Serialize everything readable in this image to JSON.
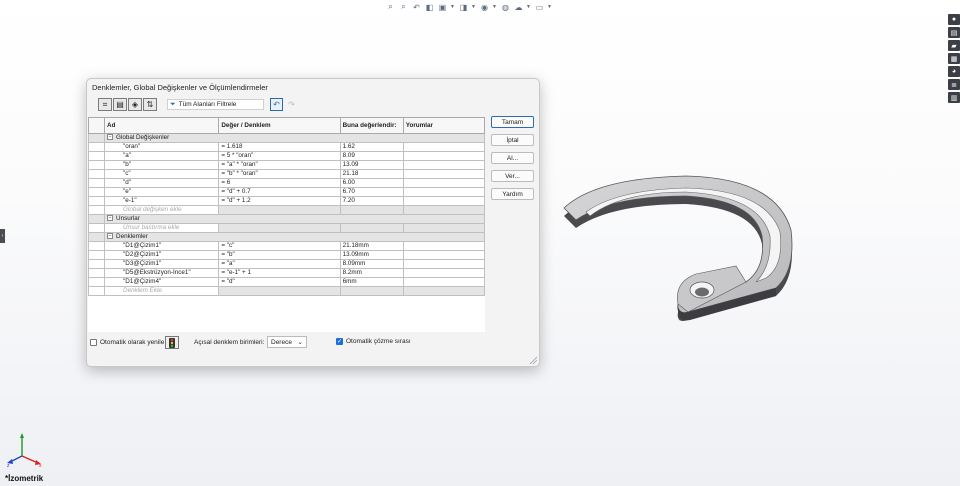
{
  "toolbar_icons": [
    "zoom-to-fit-icon",
    "zoom-area-icon",
    "previous-view-icon",
    "section-view-icon",
    "view-orientation-icon",
    "display-style-icon",
    "hide-show-icon",
    "edit-appearance-icon",
    "scene-icon",
    "view-settings-icon"
  ],
  "task_pane_icons": [
    "resources-icon",
    "design-library-icon",
    "file-explorer-icon",
    "view-palette-icon",
    "appearances-icon",
    "custom-properties-icon",
    "forum-icon"
  ],
  "dialog": {
    "title": "Denklemler, Global Değişkenler ve Ölçümlendirmeler",
    "filter_label": "Tüm Alanları Filtrele",
    "columns": [
      "Ad",
      "Değer / Denklem",
      "Buna değerlendir:",
      "Yorumlar"
    ],
    "sections": {
      "globals": {
        "header": "Global Değişkenler",
        "rows": [
          {
            "name": "\"oran\"",
            "eq": "= 1.618",
            "val": "1.62",
            "comment": ""
          },
          {
            "name": "\"a\"",
            "eq": "= 5 * \"oran\"",
            "val": "8.09",
            "comment": ""
          },
          {
            "name": "\"b\"",
            "eq": "= \"a\" * \"oran\"",
            "val": "13.09",
            "comment": ""
          },
          {
            "name": "\"c\"",
            "eq": "= \"b\" * \"oran\"",
            "val": "21.18",
            "comment": ""
          },
          {
            "name": "\"d\"",
            "eq": "= 6",
            "val": "6.00",
            "comment": ""
          },
          {
            "name": "\"e\"",
            "eq": "= \"d\" + 0.7",
            "val": "6.70",
            "comment": ""
          },
          {
            "name": "\"e-1\"",
            "eq": "= \"d\" + 1.2",
            "val": "7.20",
            "comment": ""
          }
        ],
        "placeholder": "Global değişken ekle"
      },
      "features": {
        "header": "Unsurlar",
        "placeholder": "Unsur bastırma ekle"
      },
      "equations": {
        "header": "Denklemler",
        "rows": [
          {
            "name": "\"D1@Çizim1\"",
            "eq": "= \"c\"",
            "val": "21.18mm",
            "comment": ""
          },
          {
            "name": "\"D2@Çizim1\"",
            "eq": "= \"b\"",
            "val": "13.09mm",
            "comment": ""
          },
          {
            "name": "\"D3@Çizim1\"",
            "eq": "= \"a\"",
            "val": "8.09mm",
            "comment": ""
          },
          {
            "name": "\"D5@Ekstrüzyon-İnce1\"",
            "eq": "= \"e-1\" + 1",
            "val": "8.2mm",
            "comment": ""
          },
          {
            "name": "\"D1@Çizim4\"",
            "eq": "= \"d\"",
            "val": "6mm",
            "comment": ""
          }
        ],
        "placeholder": "Denklem Ekle"
      }
    },
    "buttons": {
      "ok": "Tamam",
      "cancel": "İptal",
      "import": "Al...",
      "export": "Ver...",
      "help": "Yardım"
    },
    "auto_rebuild_label": "Otomatik olarak yenile",
    "angle_units_label": "Açısal denklem birimleri:",
    "angle_units_value": "Derece",
    "auto_solve_label": "Otomatik çözme sırası",
    "auto_rebuild_checked": false,
    "auto_solve_checked": true
  },
  "view_label": "*İzometrik",
  "colors": {
    "accent": "#1e6fd9",
    "section_bg": "#e4e4e4"
  }
}
